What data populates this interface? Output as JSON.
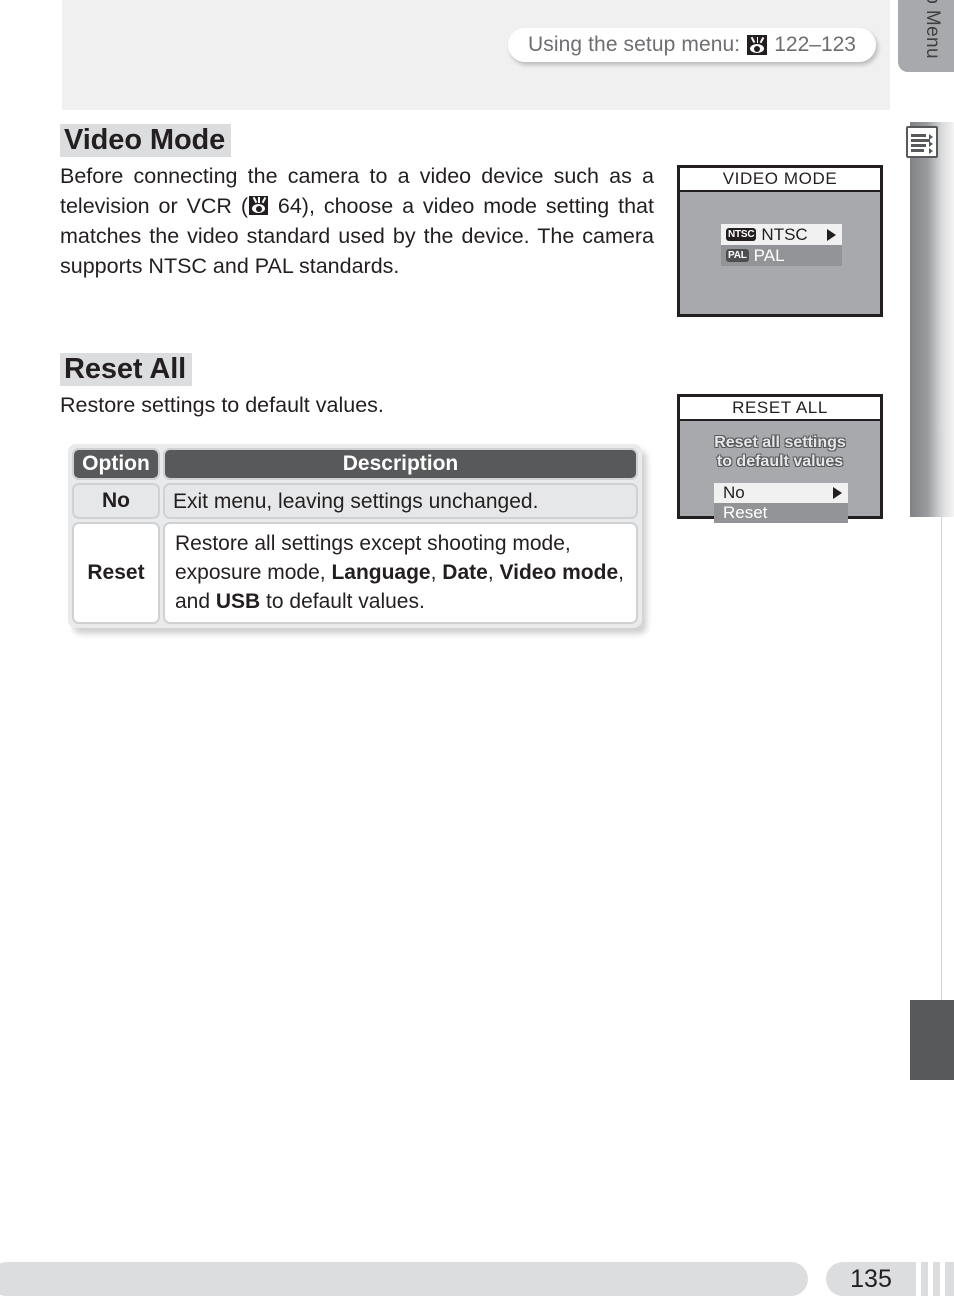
{
  "header": {
    "text": "Using the setup menu:",
    "icon": "eye-icon",
    "pages": "122–123"
  },
  "sidebar": {
    "label": "Menu Guide—The Setup Menu",
    "icon": "menu-list-icon"
  },
  "sections": [
    {
      "title": "Video Mode",
      "body_pre": "Before connecting the camera to a video device such as a television or VCR (",
      "body_icon": "eye-icon",
      "body_post": " 64), choose a video mode setting that matches the video standard used by the device.  The camera supports NTSC and PAL standards."
    },
    {
      "title": "Reset All",
      "body": "Restore settings to default values."
    }
  ],
  "table": {
    "headers": {
      "option": "Option",
      "description": "Description"
    },
    "rows": [
      {
        "option": "No",
        "description": "Exit menu, leaving settings unchanged."
      },
      {
        "option": "Reset",
        "description_parts": [
          {
            "text": "Restore all settings except shooting mode, exposure mode, ",
            "bold": false
          },
          {
            "text": "Language",
            "bold": true
          },
          {
            "text": ", ",
            "bold": false
          },
          {
            "text": "Date",
            "bold": true
          },
          {
            "text": ", ",
            "bold": false
          },
          {
            "text": "Video mode",
            "bold": true
          },
          {
            "text": ", and ",
            "bold": false
          },
          {
            "text": "USB",
            "bold": true
          },
          {
            "text": " to default values.",
            "bold": false
          }
        ]
      }
    ]
  },
  "screens": {
    "video_mode": {
      "title": "VIDEO MODE",
      "items": [
        {
          "badge": "NTSC",
          "label": "NTSC",
          "selected": true,
          "arrow": true
        },
        {
          "badge": "PAL",
          "label": "PAL",
          "selected": false,
          "arrow": false
        }
      ]
    },
    "reset_all": {
      "title": "RESET ALL",
      "message_line1": "Reset all settings",
      "message_line2": "to default values",
      "items": [
        {
          "label": "No",
          "selected": true,
          "arrow": true
        },
        {
          "label": "Reset",
          "selected": false,
          "arrow": false
        }
      ]
    }
  },
  "footer": {
    "page_number": "135"
  },
  "colors": {
    "header_band": "#f0f0f0",
    "title_highlight": "#dcdddf",
    "table_header": "#58595b",
    "screen_body": "#a7a9ac",
    "screen_selected": "#f1f1f2",
    "screen_unselected": "#929497",
    "sidebar_dark": "#58595b"
  }
}
